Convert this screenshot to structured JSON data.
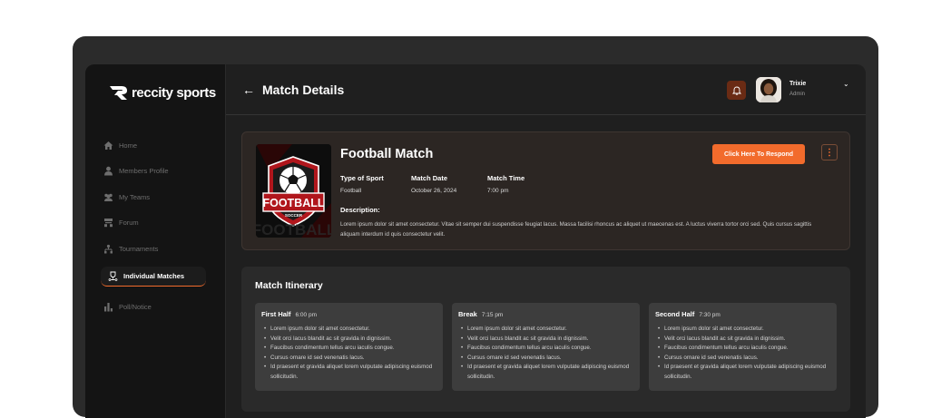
{
  "brand": {
    "name": "reccity sports"
  },
  "sidebar": {
    "items": [
      {
        "label": "Home",
        "icon": "home-icon"
      },
      {
        "label": "Members Profile",
        "icon": "user-icon"
      },
      {
        "label": "My Teams",
        "icon": "team-icon"
      },
      {
        "label": "Forum",
        "icon": "forum-icon"
      },
      {
        "label": "Tournaments",
        "icon": "tournament-icon"
      },
      {
        "label": "Individual Matches",
        "icon": "trophy-icon",
        "active": true
      },
      {
        "label": "Poll/Notice",
        "icon": "chart-icon"
      }
    ]
  },
  "header": {
    "back_arrow": "←",
    "title": "Match Details"
  },
  "user": {
    "name": "Trixie",
    "role": "Admin"
  },
  "match": {
    "title": "Football Match",
    "respond_label": "Click Here To Respond",
    "sport_label": "Type of Sport",
    "sport_value": "Football",
    "date_label": "Match Date",
    "date_value": "October 26, 2024",
    "time_label": "Match Time",
    "time_value": "7:00 pm",
    "description_label": "Description:",
    "description": "Lorem ipsum dolor sit amet consectetur. Vitae sit semper dui suspendisse feugiat lacus. Massa facilisi rhoncus ac aliquet ut maecenas est. A luctus viverra tortor orci sed. Quis cursus sagittis aliquam interdum id quis consectetur velit.",
    "thumbnail_text": "FOOTBALL",
    "thumbnail_sub": "SOCCER"
  },
  "itinerary": {
    "title": "Match Itinerary",
    "phases": [
      {
        "name": "First Half",
        "time": "6:00 pm",
        "items": [
          "Lorem ipsum dolor sit amet consectetur.",
          "Velit orci lacus blandit ac sit gravida in dignissim.",
          "Faucibus condimentum tellus arcu iaculis congue.",
          "Cursus ornare id sed venenatis lacus.",
          "Id praesent et gravida aliquet lorem vulputate adipiscing euismod sollicitudin."
        ]
      },
      {
        "name": "Break",
        "time": "7:15 pm",
        "items": [
          "Lorem ipsum dolor sit amet consectetur.",
          "Velit orci lacus blandit ac sit gravida in dignissim.",
          "Faucibus condimentum tellus arcu iaculis congue.",
          "Cursus ornare id sed venenatis lacus.",
          "Id praesent et gravida aliquet lorem vulputate adipiscing euismod sollicitudin."
        ]
      },
      {
        "name": "Second Half",
        "time": "7:30 pm",
        "items": [
          "Lorem ipsum dolor sit amet consectetur.",
          "Velit orci lacus blandit ac sit gravida in dignissim.",
          "Faucibus condimentum tellus arcu iaculis congue.",
          "Cursus ornare id sed venenatis lacus.",
          "Id praesent et gravida aliquet lorem vulputate adipiscing euismod sollicitudin."
        ]
      }
    ]
  },
  "colors": {
    "accent": "#f26b2c",
    "background": "#1f1f1f",
    "sidebar": "#141414"
  }
}
